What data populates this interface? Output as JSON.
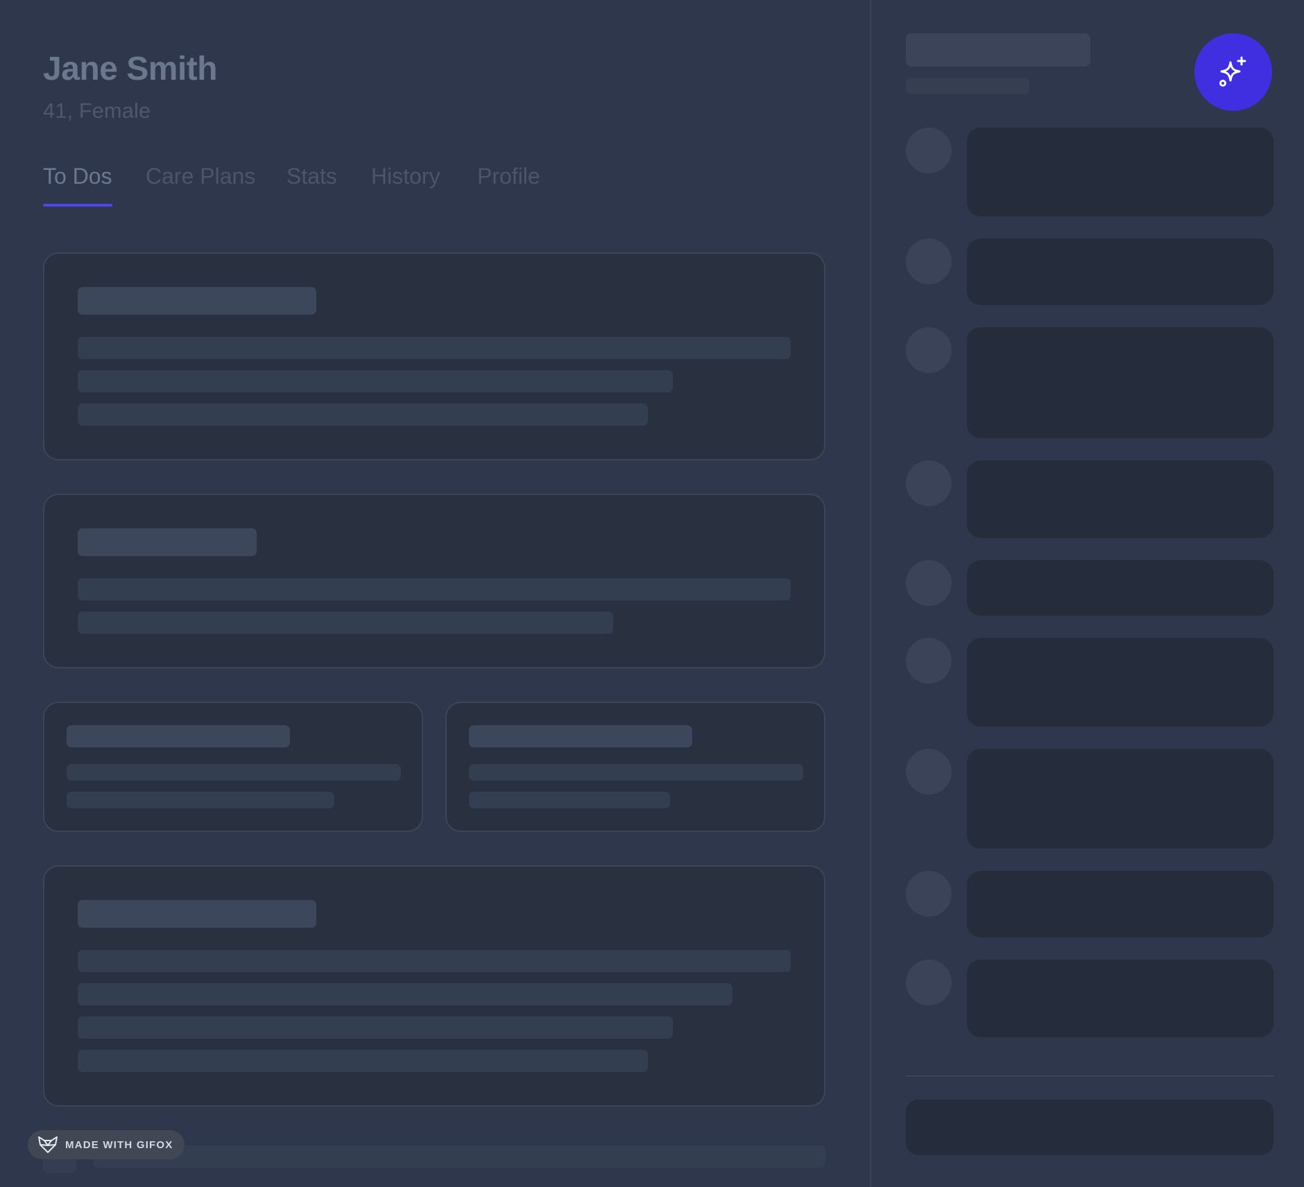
{
  "patient": {
    "name": "Jane Smith",
    "meta": "41, Female"
  },
  "tabs": [
    {
      "label": "To Dos",
      "active": true
    },
    {
      "label": "Care Plans",
      "active": false
    },
    {
      "label": "Stats",
      "active": false
    },
    {
      "label": "History",
      "active": false
    },
    {
      "label": "Profile",
      "active": false
    }
  ],
  "assistant_button": {
    "icon": "sparkles-icon",
    "color": "#3f2fe0"
  },
  "watermark": {
    "text": "MADE WITH GIFOX",
    "icon": "fox-logo-icon"
  },
  "colors": {
    "background": "#2e374b",
    "accent": "#4f46e5",
    "card": "#29303f",
    "skeleton": "#343e51"
  },
  "state": "loading-skeleton"
}
